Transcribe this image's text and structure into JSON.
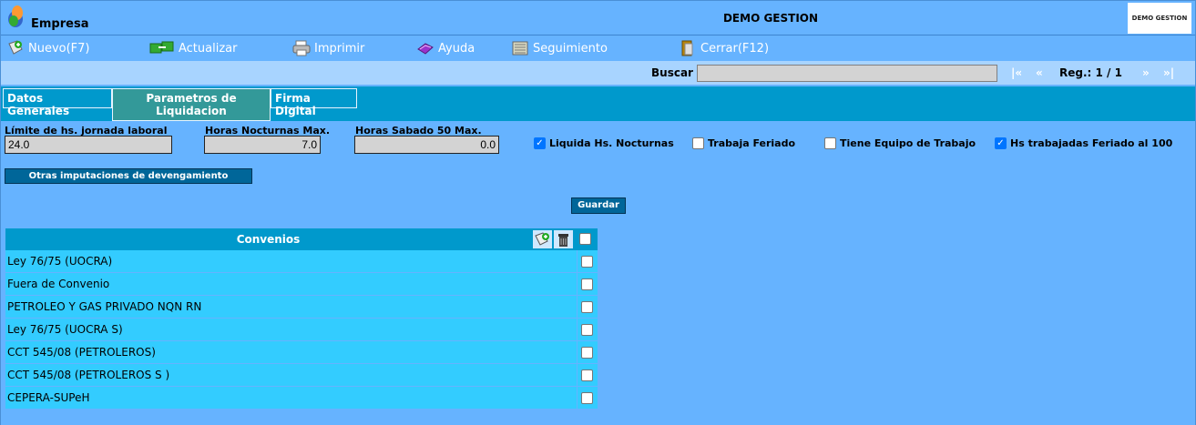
{
  "header": {
    "company": "Empresa",
    "title": "DEMO GESTION",
    "brand": "DEMO GESTION"
  },
  "toolbar": {
    "new_label": "Nuevo(F7)",
    "refresh_label": "Actualizar",
    "print_label": "Imprimir",
    "help_label": "Ayuda",
    "tracking_label": "Seguimiento",
    "close_label": "Cerrar(F12)"
  },
  "search": {
    "label": "Buscar",
    "value": "",
    "first": "|«",
    "prev": "«",
    "record": "Reg.: 1 / 1",
    "next": "»",
    "last": "»|"
  },
  "tabs": {
    "general": "Datos Generales",
    "params_line1": "Parametros de",
    "params_line2": "Liquidacion",
    "signature": "Firma Digital"
  },
  "form": {
    "limit_label": "Límite de hs. jornada laboral",
    "limit_value": "24.0",
    "night_label": "Horas Nocturnas Max.",
    "night_value": "7.0",
    "saturday_label": "Horas Sabado 50 Max.",
    "saturday_value": "0.0",
    "chk_night_label": "Liquida Hs. Nocturnas",
    "chk_night": true,
    "chk_holiday_label": "Trabaja Feriado",
    "chk_holiday": false,
    "chk_team_label": "Tiene Equipo de Trabajo",
    "chk_team": false,
    "chk_hs_label": "Hs trabajadas Feriado al 100",
    "chk_hs": true,
    "other_button": "Otras imputaciones de devengamiento",
    "save_button": "Guardar"
  },
  "convenios": {
    "title": "Convenios",
    "rows": [
      "Ley 76/75 (UOCRA)",
      "Fuera de Convenio",
      "PETROLEO Y GAS PRIVADO NQN RN",
      "Ley 76/75 (UOCRA S)",
      "CCT 545/08 (PETROLEROS)",
      "CCT 545/08 (PETROLEROS S )",
      "CEPERA-SUPeH"
    ]
  },
  "colors": {
    "background": "#66b3ff",
    "tab_bar": "#0099cc",
    "active_tab": "#339999",
    "table_row": "#33ccff",
    "search_bar": "#a8d4ff"
  }
}
